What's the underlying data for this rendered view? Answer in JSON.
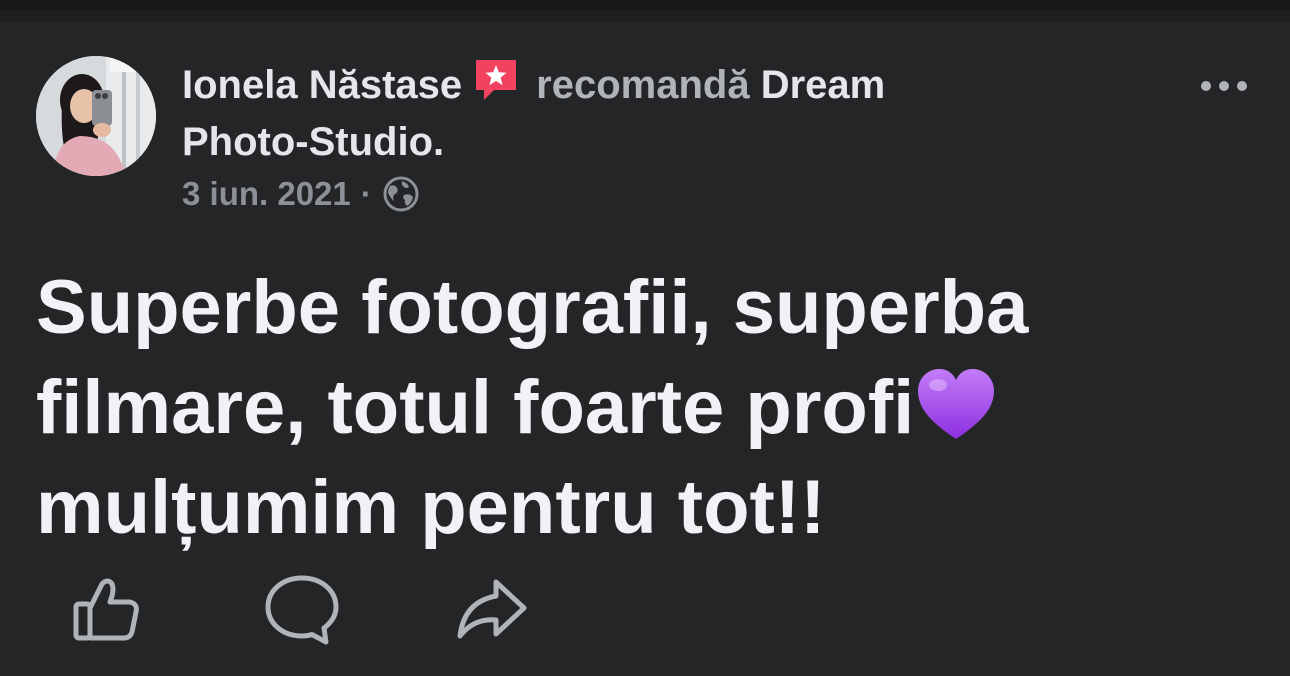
{
  "post": {
    "author_name": "Ionela Năstase",
    "recommends_text": "recomandă",
    "page_name_part1": "Dream",
    "page_name_part2": "Photo-Studio",
    "period": ".",
    "date": "3 iun. 2021",
    "separator": "·",
    "audience_icon": "globe-icon",
    "more_icon": "more-options-icon",
    "recommendation_icon": "recommend-star-icon",
    "body_lines": [
      "Superbe fotografii, superba",
      "filmare, totul foarte profi",
      "mulțumim pentru tot!!"
    ],
    "body_emoji": "purple-heart-emoji",
    "actions": {
      "like_icon": "like-icon",
      "comment_icon": "comment-icon",
      "share_icon": "share-icon"
    },
    "colors": {
      "background": "#242527",
      "primary_text": "#e4e6eb",
      "secondary_text": "#b0b3b8",
      "recommend_badge": "#f3425f",
      "heart": "#a855f7"
    }
  }
}
